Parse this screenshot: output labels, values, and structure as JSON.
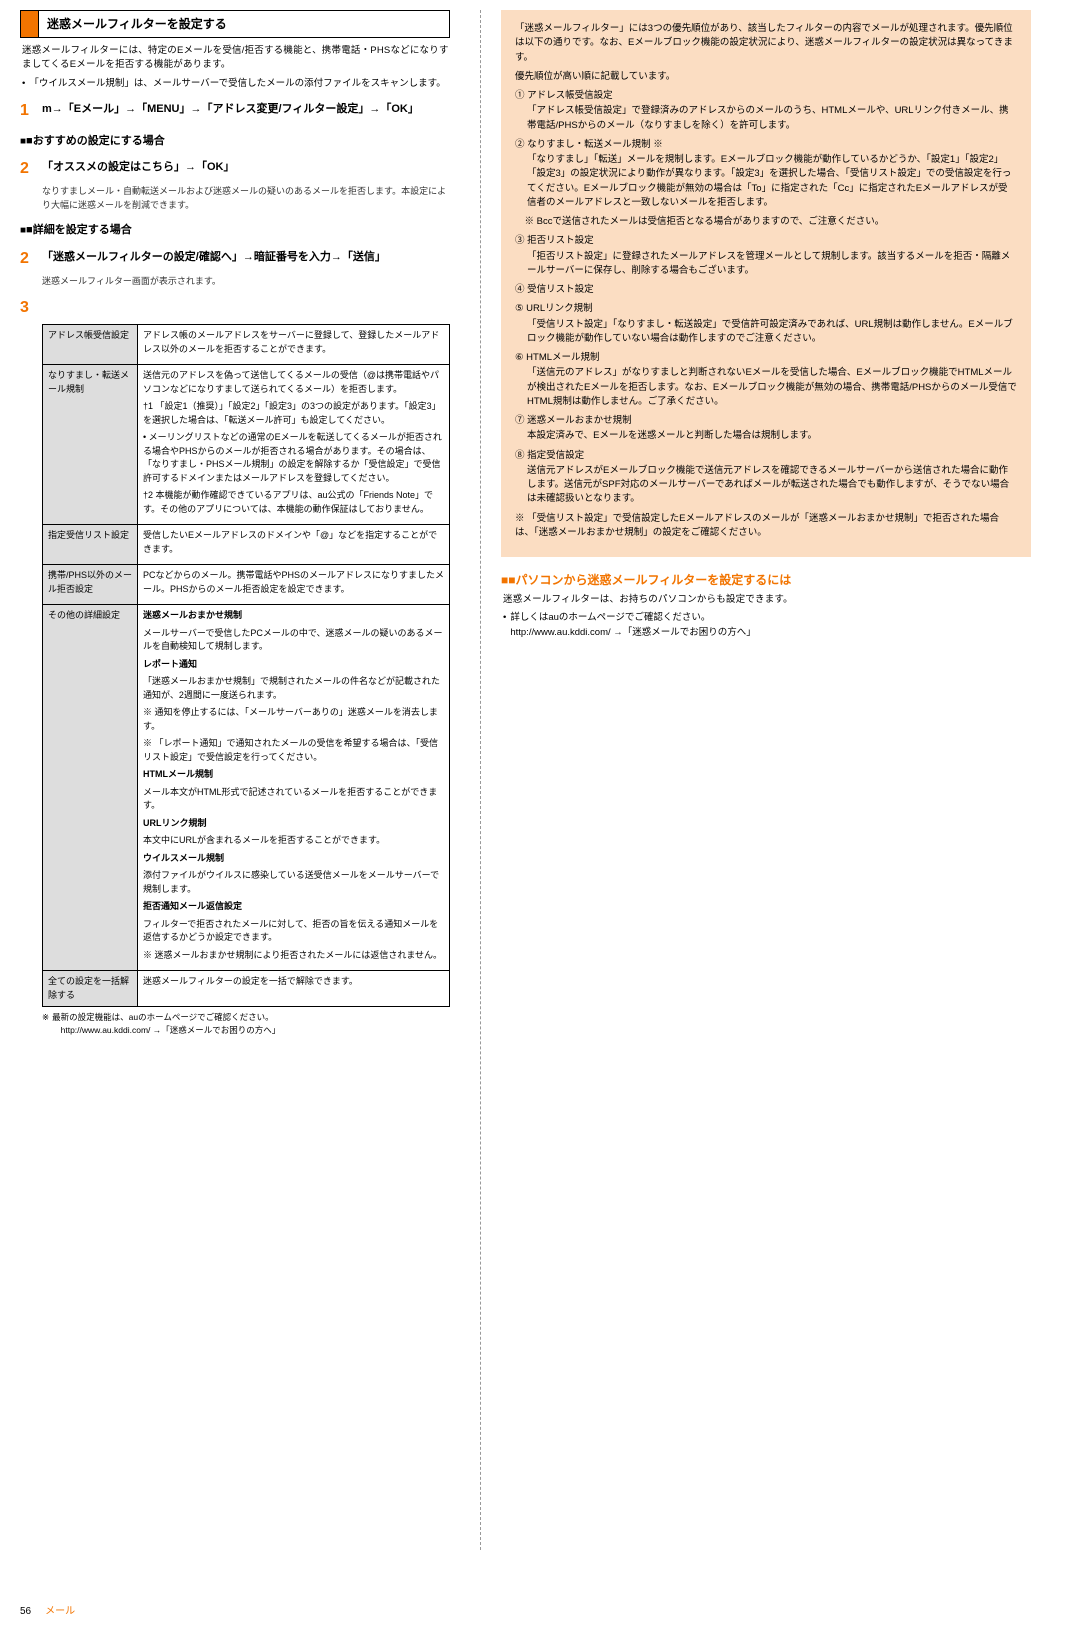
{
  "left": {
    "sectionTitle": "迷惑メールフィルターを設定する",
    "intro": "迷惑メールフィルターには、特定のEメールを受信/拒否する機能と、携帯電話・PHSなどになりすましてくるEメールを拒否する機能があります。",
    "bullet1": "「ウイルスメール規制」は、メールサーバーで受信したメールの添付ファイルをスキャンします。",
    "step1": "m→「Eメール」→「MENU」→「アドレス変更/フィルター設定」→「OK」",
    "subH1": "■おすすめの設定にする場合",
    "step2a": "「オススメの設定はこちら」→「OK」",
    "step2a_note": "なりすましメール・自動転送メールおよび迷惑メールの疑いのあるメールを拒否します。本設定により大幅に迷惑メールを削減できます。",
    "subH2": "■詳細を設定する場合",
    "step2b": "「迷惑メールフィルターの設定/確認へ」→暗証番号を入力→「送信」",
    "step2b_note": "迷惑メールフィルター画面が表示されます。",
    "table": [
      {
        "h": "アドレス帳受信設定",
        "b": [
          {
            "t": "",
            "d": "アドレス帳のメールアドレスをサーバーに登録して、登録したメールアドレス以外のメールを拒否することができます。"
          }
        ]
      },
      {
        "h": "なりすまし・転送メール規制",
        "b": [
          {
            "t": "",
            "d": "送信元のアドレスを偽って送信してくるメールの受信（@は携帯電話やパソコンなどになりすまして送られてくるメール）を拒否します。"
          },
          {
            "t": "",
            "d": "†1 「設定1（推奨）」「設定2」「設定3」の3つの設定があります。「設定3」を選択した場合は、「転送メール許可」も設定してください。"
          },
          {
            "t": "",
            "d": "• メーリングリストなどの通常のEメールを転送してくるメールが拒否される場合やPHSからのメールが拒否される場合があります。その場合は、「なりすまし・PHSメール規制」の設定を解除するか「受信設定」で受信許可するドメインまたはメールアドレスを登録してください。"
          },
          {
            "t": "",
            "d": "†2 本機能が動作確認できているアプリは、au公式の「Friends Note」です。その他のアプリについては、本機能の動作保証はしておりません。"
          }
        ]
      },
      {
        "h": "指定受信リスト設定",
        "b": [
          {
            "t": "",
            "d": "受信したいEメールアドレスのドメインや「@」などを指定することができます。"
          }
        ]
      },
      {
        "h": "携帯/PHS以外のメール拒否設定",
        "b": [
          {
            "t": "",
            "d": "PCなどからのメール。携帯電話やPHSのメールアドレスになりすましたメール。PHSからのメール拒否設定を設定できます。"
          }
        ]
      },
      {
        "h": "その他の詳細設定",
        "b": [
          {
            "t": "迷惑メールおまかせ規制",
            "d": ""
          },
          {
            "t": "",
            "d": "メールサーバーで受信したPCメールの中で、迷惑メールの疑いのあるメールを自動検知して規制します。"
          },
          {
            "t": "レポート通知",
            "d": ""
          },
          {
            "t": "",
            "d": "「迷惑メールおまかせ規制」で規制されたメールの件名などが記載された通知が、2週間に一度送られます。"
          },
          {
            "t": "",
            "d": "※ 通知を停止するには、「メールサーバーありの」迷惑メールを消去します。"
          },
          {
            "t": "",
            "d": "※ 「レポート通知」で通知されたメールの受信を希望する場合は、「受信リスト設定」で受信設定を行ってください。"
          },
          {
            "t": "HTMLメール規制",
            "d": ""
          },
          {
            "t": "",
            "d": "メール本文がHTML形式で記述されているメールを拒否することができます。"
          },
          {
            "t": "URLリンク規制",
            "d": ""
          },
          {
            "t": "",
            "d": "本文中にURLが含まれるメールを拒否することができます。"
          },
          {
            "t": "ウイルスメール規制",
            "d": ""
          },
          {
            "t": "",
            "d": "添付ファイルがウイルスに感染している送受信メールをメールサーバーで規制します。"
          },
          {
            "t": "拒否通知メール返信設定",
            "d": ""
          },
          {
            "t": "",
            "d": "フィルターで拒否されたメールに対して、拒否の旨を伝える通知メールを返信するかどうか設定できます。"
          },
          {
            "t": "",
            "d": "※ 迷惑メールおまかせ規制により拒否されたメールには返信されません。"
          }
        ]
      },
      {
        "h": "全ての設定を一括解除する",
        "b": [
          {
            "t": "",
            "d": "迷惑メールフィルターの設定を一括で解除できます。"
          }
        ]
      }
    ],
    "note1_mk": "※",
    "note1": " 最新の設定機能は、auのホームページでご確認ください。\n　http://www.au.kddi.com/ →「迷惑メールでお困りの方へ」"
  },
  "right": {
    "box": {
      "p1": "「迷惑メールフィルター」には3つの優先順位があり、該当したフィルターの内容でメールが処理されます。優先順位は以下の通りです。なお、Eメールブロック機能の設定状況により、迷惑メールフィルターの設定状況は異なってきます。",
      "p2": "優先順位が高い順に記載しています。",
      "items": [
        {
          "l": "① アドレス帳受信設定",
          "d": "「アドレス帳受信設定」で登録済みのアドレスからのメールのうち、HTMLメールや、URLリンク付きメール、携帯電話/PHSからのメール（なりすましを除く）を許可します。"
        },
        {
          "l": "② なりすまし・転送メール規制 ※",
          "d": "「なりすまし」「転送」メールを規制します。Eメールブロック機能が動作しているかどうか、「設定1」「設定2」「設定3」の設定状況により動作が異なります。「設定3」を選択した場合、「受信リスト設定」での受信設定を行ってください。Eメールブロック機能が無効の場合は「To」に指定された「Cc」に指定されたEメールアドレスが受信者のメールアドレスと一致しないメールを拒否します。"
        },
        {
          "l": "　※ Bccで送信されたメールは受信拒否となる場合がありますので、ご注意ください。",
          "d": ""
        },
        {
          "l": "③ 拒否リスト設定",
          "d": "「拒否リスト設定」に登録されたメールアドレスを管理メールとして規制します。該当するメールを拒否・隔離メールサーバーに保存し、削除する場合もございます。"
        },
        {
          "l": "④ 受信リスト設定",
          "d": ""
        },
        {
          "l": "⑤ URLリンク規制",
          "d": "「受信リスト設定」「なりすまし・転送設定」で受信許可設定済みであれば、URL規制は動作しません。Eメールブロック機能が動作していない場合は動作しますのでご注意ください。"
        },
        {
          "l": "⑥ HTMLメール規制",
          "d": "「送信元のアドレス」がなりすましと判断されないEメールを受信した場合、Eメールブロック機能でHTMLメールが検出されたEメールを拒否します。なお、Eメールブロック機能が無効の場合、携帯電話/PHSからのメール受信でHTML規制は動作しません。ご了承ください。"
        },
        {
          "l": "⑦ 迷惑メールおまかせ規制",
          "d": "本設定済みで、Eメールを迷惑メールと判断した場合は規制します。"
        },
        {
          "l": "⑧ 指定受信設定",
          "d": "送信元アドレスがEメールブロック機能で送信元アドレスを確認できるメールサーバーから送信された場合に動作します。送信元がSPF対応のメールサーバーであればメールが転送された場合でも動作しますが、そうでない場合は未確認扱いとなります。"
        },
        {
          "l": "※ 「受信リスト設定」で受信設定したEメールアドレスのメールが「迷惑メールおまかせ規制」で拒否された場合は、「迷惑メールおまかせ規制」の設定をご確認ください。",
          "d": ""
        }
      ]
    },
    "subhead": "■パソコンから迷惑メールフィルターを設定するには",
    "txt1": "迷惑メールフィルターは、お持ちのパソコンからも設定できます。",
    "bullet": "詳しくはauのホームページでご確認ください。\nhttp://www.au.kddi.com/ →「迷惑メールでお困りの方へ」"
  },
  "footer": {
    "page": "56",
    "cat": "メール"
  }
}
